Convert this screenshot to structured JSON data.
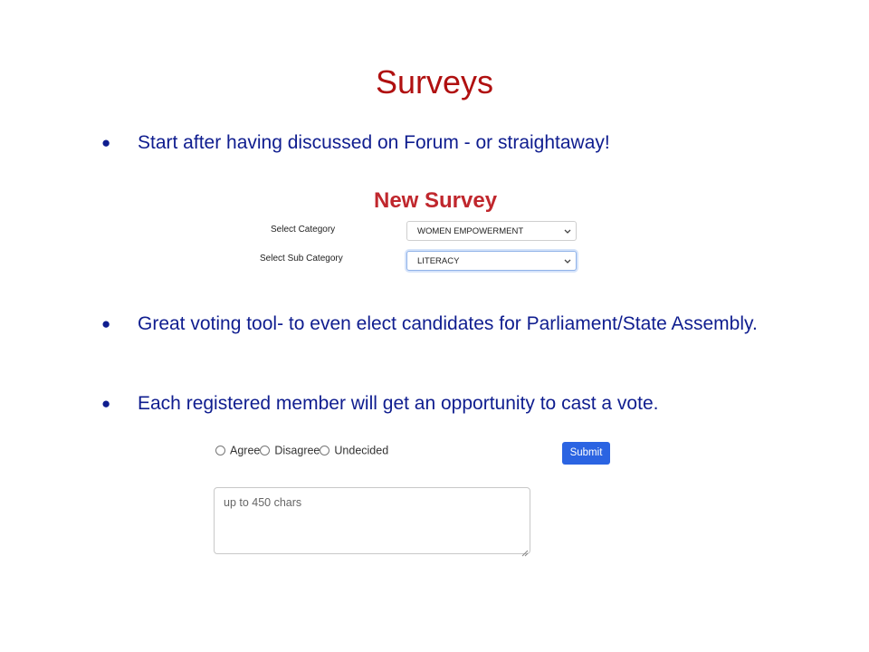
{
  "slide": {
    "title": "Surveys"
  },
  "bullets": [
    {
      "symbol": "●",
      "text": "Start after having discussed on Forum - or straightaway!"
    },
    {
      "symbol": "●",
      "text": "Great voting tool- to even elect candidates for Parliament/State Assembly."
    },
    {
      "symbol": "●",
      "text": "Each registered member will get an opportunity to cast a vote."
    }
  ],
  "new_survey": {
    "title": "New Survey",
    "category_label": "Select Category",
    "category_value": "WOMEN EMPOWERMENT",
    "subcategory_label": "Select Sub Category",
    "subcategory_value": "LITERACY",
    "chevron_icon": "chevron-down-icon"
  },
  "vote": {
    "options": [
      "Agree",
      "Disagree",
      "Undecided"
    ],
    "submit_label": "Submit",
    "comment_placeholder": "up to 450 chars"
  },
  "colors": {
    "title": "#b01010",
    "bullet_text": "#0f1d8f",
    "new_survey_title": "#c0272d",
    "submit_bg": "#2b64e2"
  }
}
